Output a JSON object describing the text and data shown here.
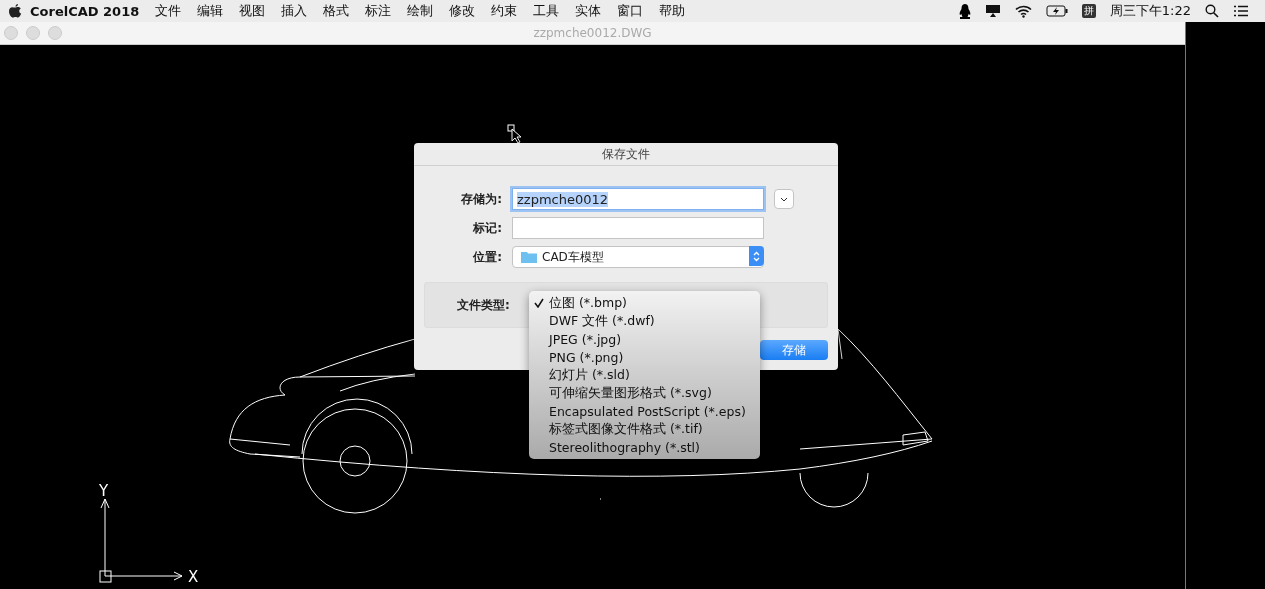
{
  "menubar": {
    "app_name": "CorelCAD 2018",
    "menus": [
      "文件",
      "编辑",
      "视图",
      "插入",
      "格式",
      "标注",
      "绘制",
      "修改",
      "约束",
      "工具",
      "实体",
      "窗口",
      "帮助"
    ],
    "input_method": "拼",
    "clock": "周三下午1:22"
  },
  "window": {
    "title": "zzpmche0012.DWG"
  },
  "ucs": {
    "x_label": "X",
    "y_label": "Y"
  },
  "dialog": {
    "title": "保存文件",
    "save_as": {
      "label": "存储为:",
      "value": "zzpmche0012"
    },
    "tags": {
      "label": "标记:"
    },
    "location": {
      "label": "位置:",
      "value": "CAD车模型"
    },
    "file_type": {
      "label": "文件类型:"
    },
    "save_button": "存储",
    "file_type_menu": [
      {
        "label": "位图 (*.bmp)",
        "selected": true
      },
      {
        "label": "DWF 文件 (*.dwf)",
        "selected": false
      },
      {
        "label": "JPEG (*.jpg)",
        "selected": false
      },
      {
        "label": "PNG (*.png)",
        "selected": false
      },
      {
        "label": "幻灯片 (*.sld)",
        "selected": false
      },
      {
        "label": "可伸缩矢量图形格式 (*.svg)",
        "selected": false
      },
      {
        "label": "Encapsulated PostScript (*.eps)",
        "selected": false
      },
      {
        "label": "标签式图像文件格式 (*.tif)",
        "selected": false
      },
      {
        "label": "Stereolithography (*.stl)",
        "selected": false
      }
    ]
  }
}
